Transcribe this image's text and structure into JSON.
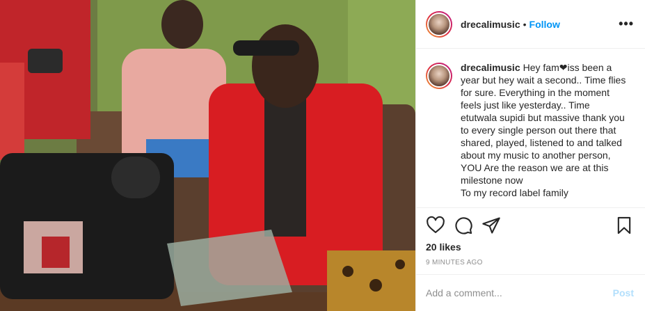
{
  "post": {
    "photo_alt": "",
    "header": {
      "username": "drecalimusic",
      "separator": "•",
      "follow_label": "Follow",
      "more_label": "•••"
    },
    "caption": {
      "username": "drecalimusic",
      "text": "Hey fam❤iss been a year but hey wait a second.. Time flies for sure. Everything in the moment feels just like yesterday.. Time etutwala supidi but massive thank you to every single person out there that shared, played, listened to and talked about my music to another person, YOU Are the reason we are at this milestone now\nTo my record label family"
    },
    "actions": {
      "like_icon": "heart-icon",
      "comment_icon": "comment-icon",
      "share_icon": "share-icon",
      "save_icon": "bookmark-icon"
    },
    "likes": "20 likes",
    "time_ago": "9 MINUTES AGO",
    "comment_box": {
      "placeholder": "Add a comment...",
      "post_label": "Post"
    },
    "colors": {
      "follow": "#0095f6",
      "post_disabled": "#b2dffc",
      "muted": "#8e8e8e",
      "text": "#262626"
    }
  }
}
